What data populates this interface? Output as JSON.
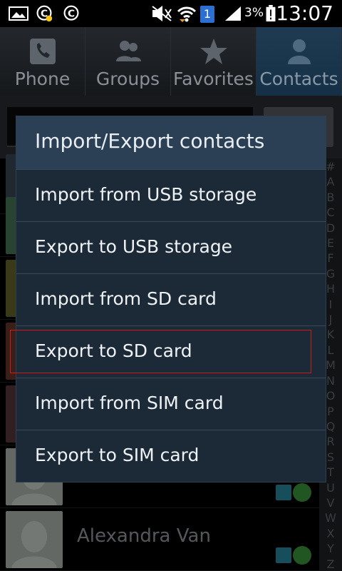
{
  "status_bar": {
    "time": "13:07",
    "battery_percent": "3%",
    "notification_badge": "1",
    "icons": [
      "image-icon",
      "c-circle-icon",
      "c-circle-icon",
      "mute-icon",
      "wifi-icon",
      "notification-icon",
      "signal-icon",
      "battery-icon"
    ]
  },
  "tabs": [
    {
      "label": "Phone",
      "icon": "phone-icon"
    },
    {
      "label": "Groups",
      "icon": "groups-icon"
    },
    {
      "label": "Favorites",
      "icon": "star-icon"
    },
    {
      "label": "Contacts",
      "icon": "contact-icon",
      "active": true
    }
  ],
  "contacts": [
    {
      "name": ""
    },
    {
      "name": ""
    },
    {
      "name": ""
    },
    {
      "name": ""
    },
    {
      "name": ""
    },
    {
      "name": ""
    },
    {
      "name": "Alexandra Van"
    }
  ],
  "index_letters": [
    "#",
    "A",
    "B",
    "C",
    "D",
    "E",
    "F",
    "G",
    "H",
    "I",
    "J",
    "K",
    "L",
    "M",
    "N",
    "O",
    "P",
    "Q",
    "R",
    "S",
    "T",
    "U",
    "V",
    "W",
    "X",
    "Y",
    "Z"
  ],
  "dialog": {
    "title": "Import/Export contacts",
    "items": [
      "Import from USB storage",
      "Export to USB storage",
      "Import from SD card",
      "Export to SD card",
      "Import from SIM card",
      "Export to SIM card"
    ]
  },
  "colors": {
    "dialog_bg": "#1c2a38",
    "dialog_title_bg": "#2b3f55",
    "active_tab": "#1e3b52",
    "highlight_border": "#d01919"
  }
}
